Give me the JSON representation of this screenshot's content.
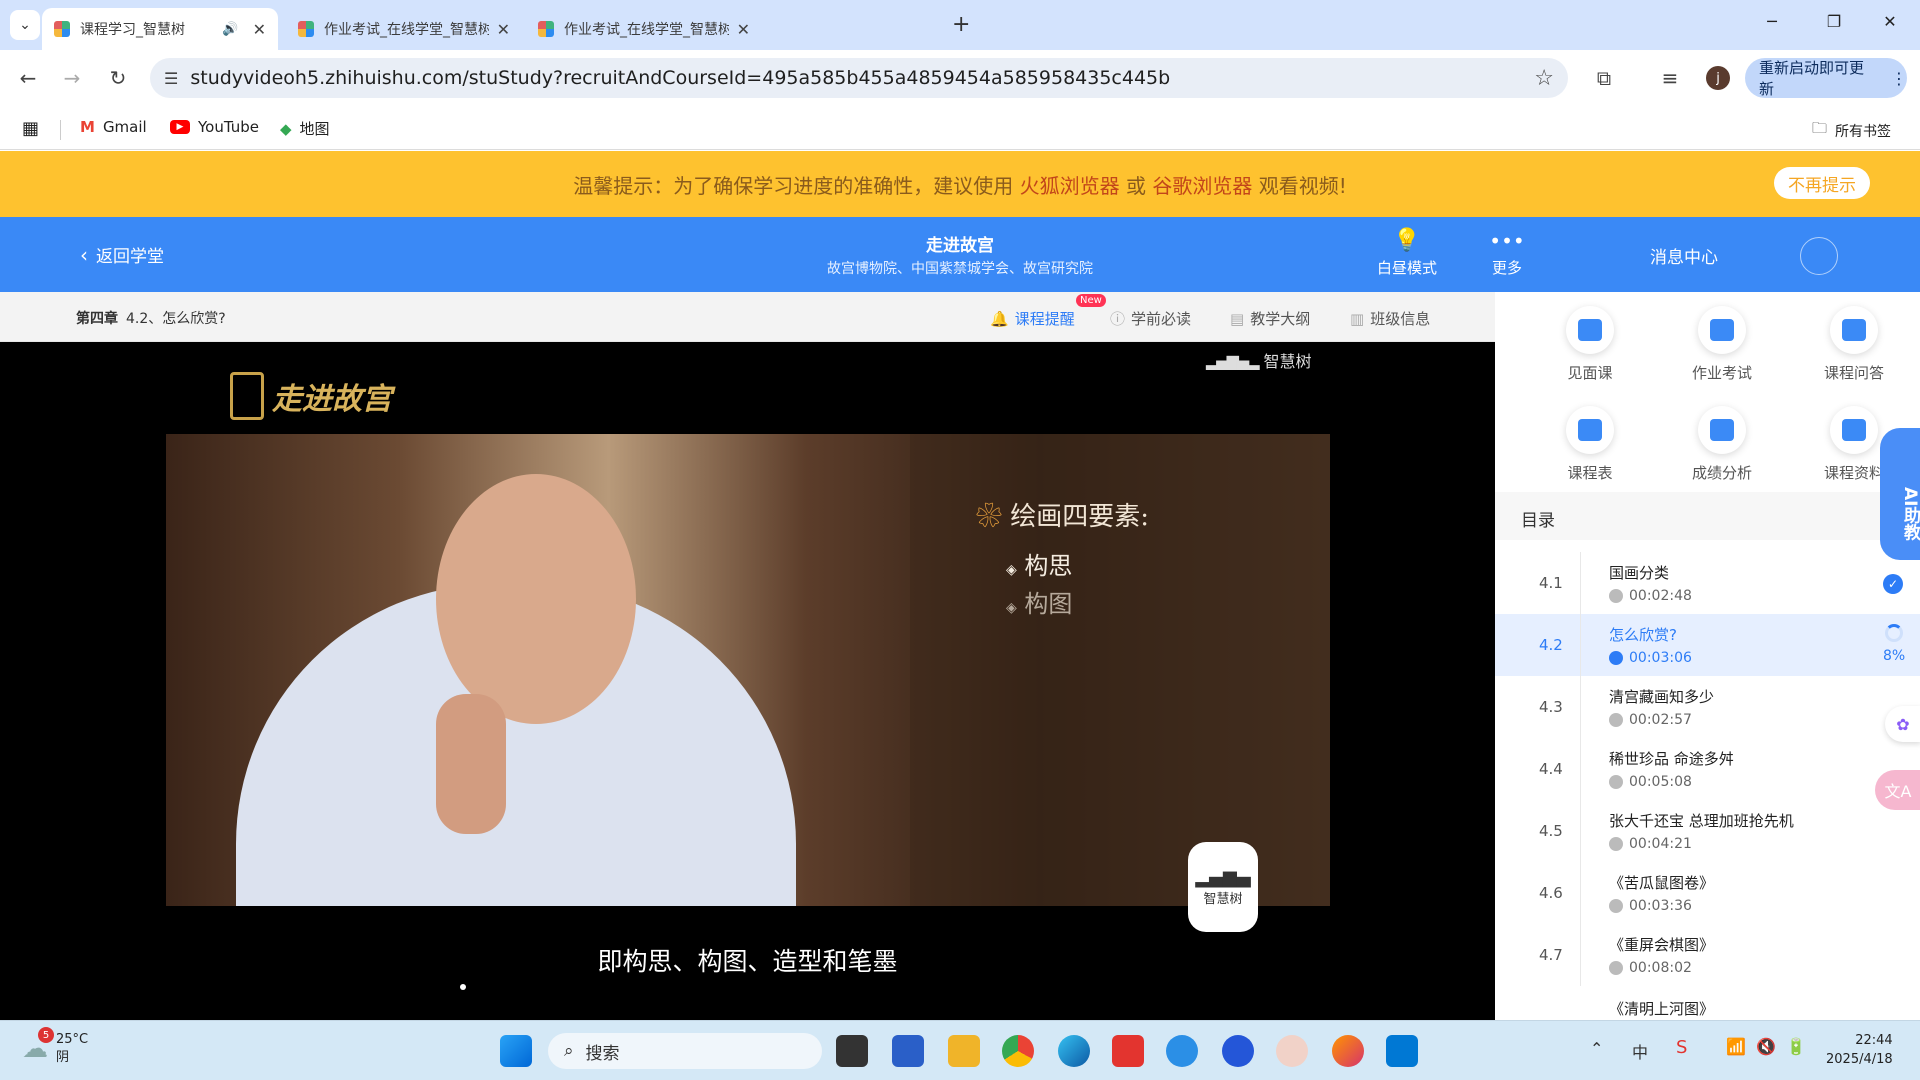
{
  "browser": {
    "tabs": [
      {
        "title": "课程学习_智慧树"
      },
      {
        "title": "作业考试_在线学堂_智慧树"
      },
      {
        "title": "作业考试_在线学堂_智慧树"
      }
    ],
    "url": "studyvideoh5.zhihuishu.com/stuStudy?recruitAndCourseId=495a585b455a4859454a585958435c445b",
    "profile_initial": "j",
    "update_label": "重新启动即可更新",
    "bookmarks": [
      "Gmail",
      "YouTube",
      "地图"
    ],
    "all_bookmarks": "所有书签"
  },
  "banner": {
    "prefix": "温馨提示：为了确保学习进度的准确性，建议使用",
    "firefox": "火狐浏览器",
    "or": "或",
    "chrome": "谷歌浏览器",
    "suffix": "观看视频!",
    "dismiss": "不再提示"
  },
  "header": {
    "back": "返回学堂",
    "course_title": "走进故宫",
    "course_org": "故宫博物院、中国紫禁城学会、故宫研究院",
    "day_mode": "白昼模式",
    "more": "更多",
    "messages": "消息中心"
  },
  "chapter_bar": {
    "chapter": "第四章",
    "section": "4.2、怎么欣赏?",
    "tabs": [
      "课程提醒",
      "学前必读",
      "教学大纲",
      "班级信息"
    ],
    "new_badge": "New"
  },
  "video": {
    "logo": "走进故宫",
    "watermark": "智慧树",
    "panel_title": "绘画四要素:",
    "panel_items": [
      "构思",
      "构图"
    ],
    "subtitle": "即构思、构图、造型和笔墨",
    "badge": "智慧树"
  },
  "sidebar": {
    "tools": [
      "见面课",
      "作业考试",
      "课程问答",
      "课程表",
      "成绩分析",
      "课程资料"
    ],
    "toc_title": "目录",
    "ai_label": "AI助教",
    "toc": [
      {
        "num": "4.1",
        "title": "国画分类",
        "duration": "00:02:48",
        "status": "done"
      },
      {
        "num": "4.2",
        "title": "怎么欣赏?",
        "duration": "00:03:06",
        "status": "active",
        "progress": "8%"
      },
      {
        "num": "4.3",
        "title": "清宫藏画知多少",
        "duration": "00:02:57"
      },
      {
        "num": "4.4",
        "title": "稀世珍品 命途多舛",
        "duration": "00:05:08"
      },
      {
        "num": "4.5",
        "title": "张大千还宝 总理加班抢先机",
        "duration": "00:04:21"
      },
      {
        "num": "4.6",
        "title": "《苦瓜鼠图卷》",
        "duration": "00:03:36"
      },
      {
        "num": "4.7",
        "title": "《重屏会棋图》",
        "duration": "00:08:02"
      }
    ],
    "toc_cutoff": "《清明上河图》"
  },
  "taskbar": {
    "weather_temp": "25°C",
    "weather_desc": "阴",
    "weather_badge": "5",
    "search": "搜索",
    "time": "22:44",
    "date": "2025/4/18",
    "ime": "中"
  }
}
